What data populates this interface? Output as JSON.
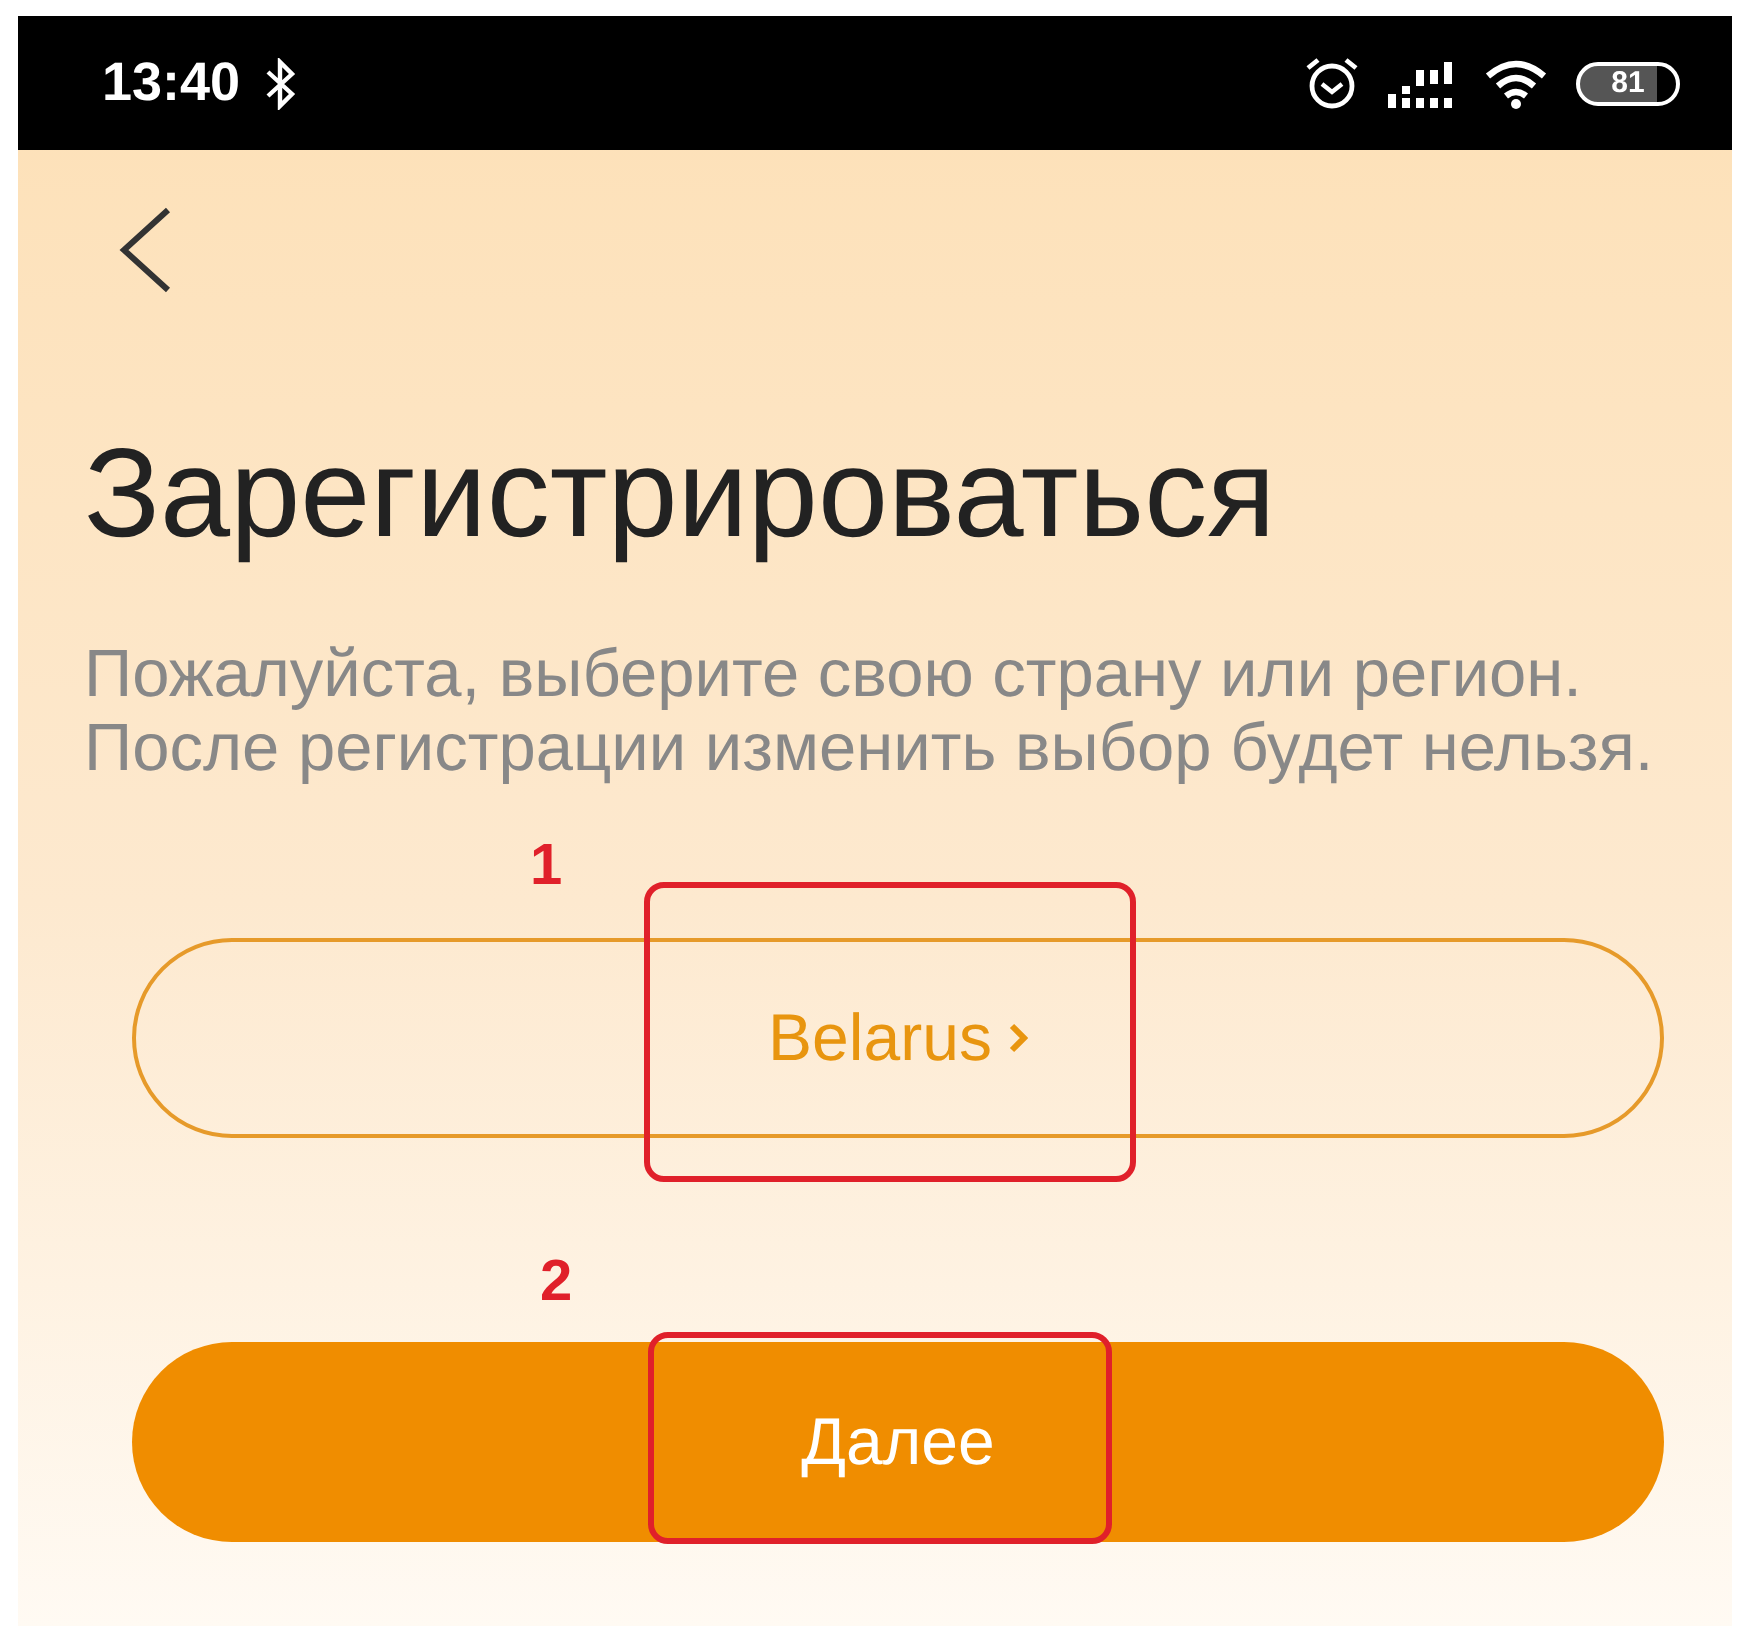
{
  "status_bar": {
    "time": "13:40",
    "battery": "81"
  },
  "title": "Зарегистрироваться",
  "subtitle_lines": [
    "Пожалуйста, выберите свою страну или регион.",
    "После регистрации изменить выбор будет нельзя."
  ],
  "country_button": {
    "label": "Belarus",
    "annotation": "1"
  },
  "next_button": {
    "label": "Далее",
    "annotation": "2"
  }
}
